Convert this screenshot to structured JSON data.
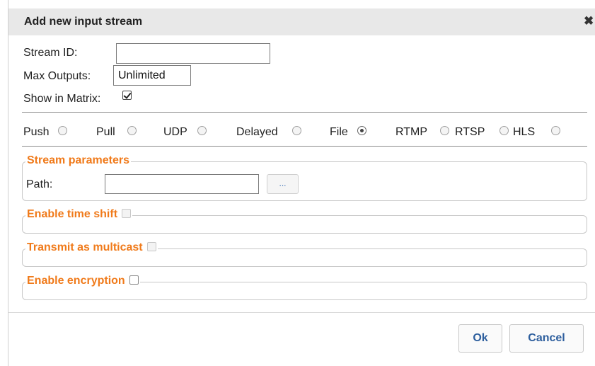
{
  "dialog": {
    "title": "Add new input stream",
    "close_symbol": "✖"
  },
  "form": {
    "stream_id_label": "Stream ID:",
    "stream_id_value": "",
    "max_outputs_label": "Max Outputs:",
    "max_outputs_value": "Unlimited",
    "show_in_matrix_label": "Show in Matrix:",
    "show_in_matrix_checked": true
  },
  "stream_types": [
    {
      "label": "Push",
      "selected": false
    },
    {
      "label": "Pull",
      "selected": false
    },
    {
      "label": "UDP",
      "selected": false
    },
    {
      "label": "Delayed",
      "selected": false
    },
    {
      "label": "File",
      "selected": true
    },
    {
      "label": "RTMP",
      "selected": false
    },
    {
      "label": "RTSP",
      "selected": false
    },
    {
      "label": "HLS",
      "selected": false
    }
  ],
  "stream_parameters": {
    "legend": "Stream parameters",
    "path_label": "Path:",
    "path_value": "",
    "browse_label": "..."
  },
  "sections": {
    "time_shift": "Enable time shift",
    "multicast": "Transmit as multicast",
    "encryption": "Enable encryption"
  },
  "buttons": {
    "ok": "Ok",
    "cancel": "Cancel"
  },
  "colors": {
    "section_legend": "#f07a1a",
    "button_text": "#2e5f9e"
  }
}
